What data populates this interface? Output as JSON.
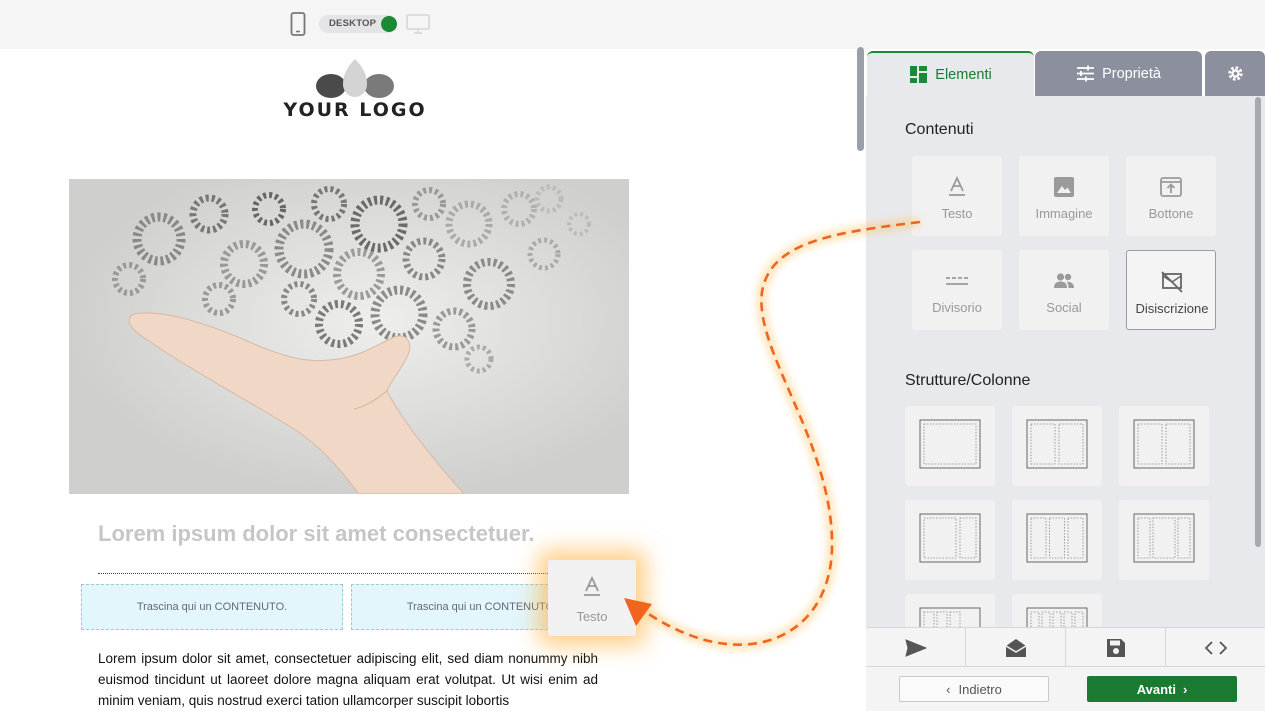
{
  "topbar": {
    "device_label": "DESKTOP"
  },
  "email": {
    "logo_text": "YOUR LOGO",
    "headline": "Lorem ipsum dolor sit amet consectetuer.",
    "drop_zone_1": "Trascina qui un CONTENUTO.",
    "drop_zone_2": "Trascina qui un CONTENUTO.",
    "body_text": "Lorem ipsum dolor sit amet, consectetuer adipiscing elit, sed diam nonummy nibh euismod tincidunt ut laoreet dolore magna aliquam erat volutpat. Ut wisi enim ad minim veniam, quis nostrud exerci tation ullamcorper suscipit lobortis"
  },
  "drag_ghost": {
    "label": "Testo"
  },
  "panel": {
    "tabs": {
      "elements": "Elementi",
      "properties": "Proprietà"
    },
    "contents_title": "Contenuti",
    "blocks": {
      "text": "Testo",
      "image": "Immagine",
      "button": "Bottone",
      "divider": "Divisorio",
      "social": "Social",
      "unsubscribe": "Disiscrizione"
    },
    "structures_title": "Strutture/Colonne",
    "nav": {
      "back": "Indietro",
      "next": "Avanti"
    }
  },
  "colors": {
    "accent": "#1b8a36",
    "drag_arrow": "#f0641e"
  }
}
